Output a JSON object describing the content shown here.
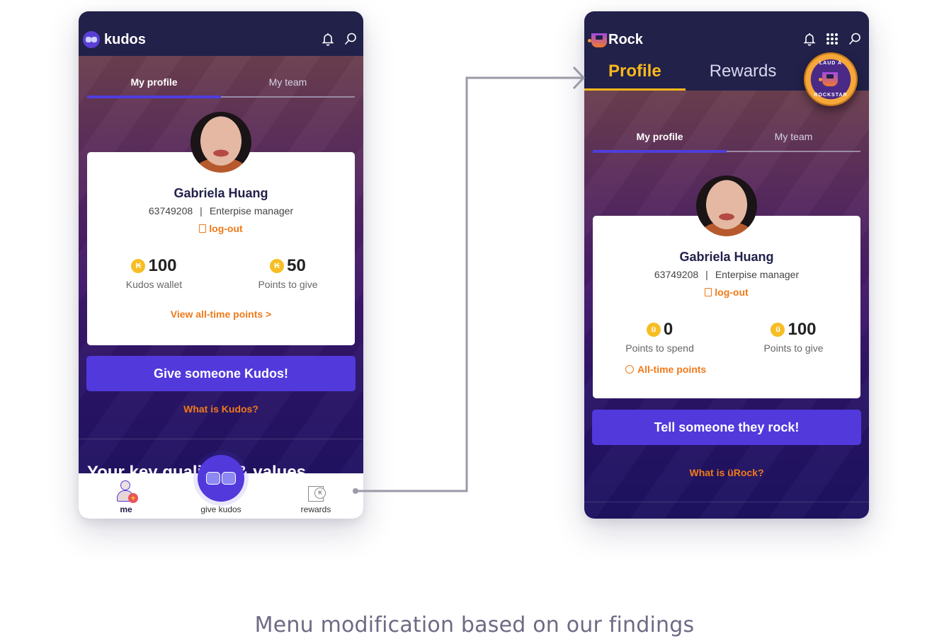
{
  "caption": "Menu modification based on our findings",
  "before": {
    "app_name": "kudos",
    "top_icons": [
      "bell-icon",
      "search-icon"
    ],
    "sub_tabs": [
      {
        "label": "My profile",
        "active": true
      },
      {
        "label": "My team",
        "active": false
      }
    ],
    "profile": {
      "name": "Gabriela Huang",
      "employee_id": "63749208",
      "separator": "|",
      "role": "Enterpise manager",
      "logout_label": "log-out"
    },
    "stats": [
      {
        "coin": "₭",
        "value": "100",
        "label": "Kudos wallet"
      },
      {
        "coin": "₭",
        "value": "50",
        "label": "Points to give"
      }
    ],
    "all_time_link": "View all-time points >",
    "cta_label": "Give someone Kudos!",
    "what_is_link": "What is Kudos?",
    "section_heading": "Your key qualities & values",
    "bottom_nav": [
      {
        "label": "me",
        "icon": "person-add-icon",
        "active": true
      },
      {
        "label": "give kudos",
        "icon": "fist-bump-icon",
        "active": false
      },
      {
        "label": "rewards",
        "icon": "gift-icon",
        "active": false
      }
    ]
  },
  "after": {
    "app_name": "Rock",
    "top_icons": [
      "bell-icon",
      "apps-grid-icon",
      "search-icon"
    ],
    "main_tabs": [
      {
        "label": "Profile",
        "active": true
      },
      {
        "label": "Rewards",
        "active": false
      }
    ],
    "badge": {
      "top_text": "LAUD A",
      "bottom_text": "ROCKSTAR"
    },
    "sub_tabs": [
      {
        "label": "My profile",
        "active": true
      },
      {
        "label": "My team",
        "active": false
      }
    ],
    "profile": {
      "name": "Gabriela Huang",
      "employee_id": "63749208",
      "separator": "|",
      "role": "Enterpise manager",
      "logout_label": "log-out"
    },
    "stats": [
      {
        "coin": "ü",
        "value": "0",
        "label": "Points to spend"
      },
      {
        "coin": "ü",
        "value": "100",
        "label": "Points to give"
      }
    ],
    "all_time_link": "All-time points",
    "cta_label": "Tell someone they rock!",
    "what_is_link": "What is üRock?"
  },
  "colors": {
    "topbar": "#22214a",
    "accent_purple": "#5139dc",
    "accent_orange": "#f07a1a",
    "accent_yellow": "#f8b81c",
    "coin": "#f6be24",
    "connector": "#9a9aa8"
  }
}
